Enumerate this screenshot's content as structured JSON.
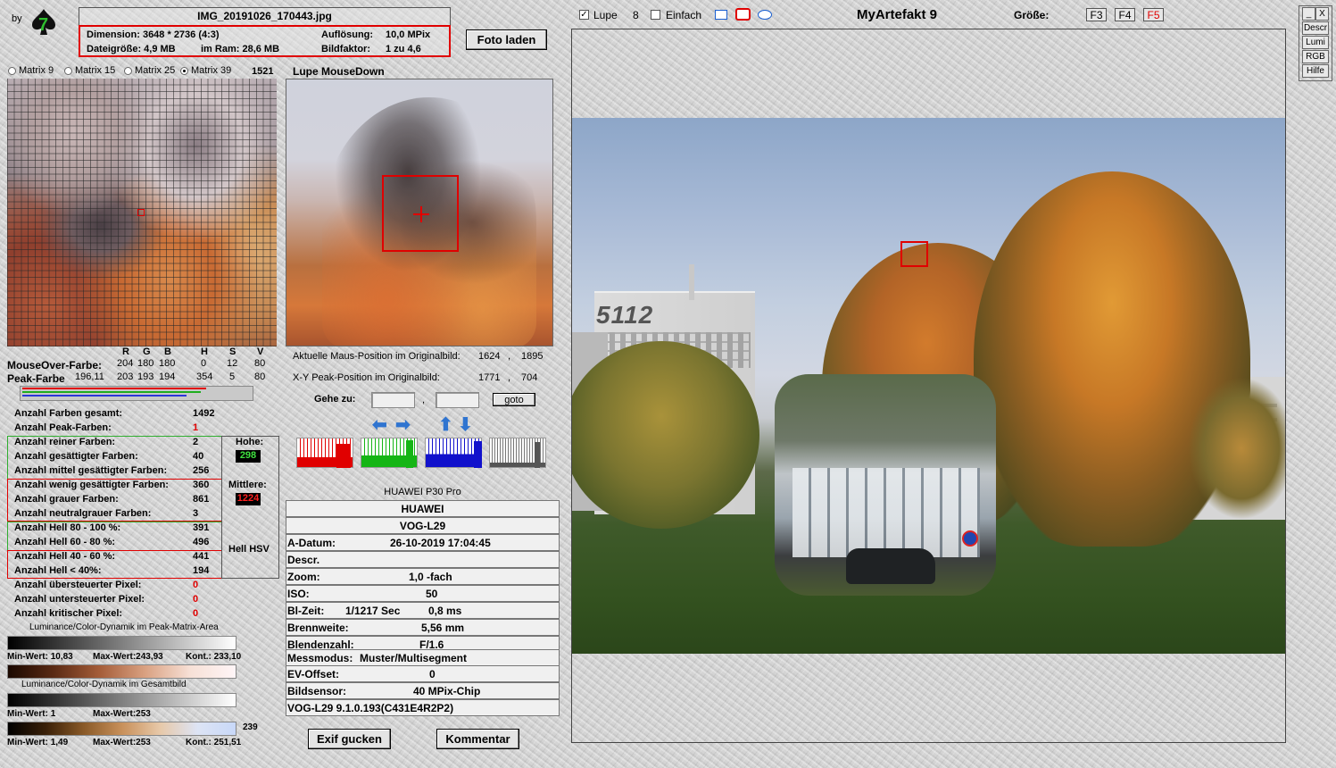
{
  "app": {
    "by_label": "by",
    "title": "MyArtefakt 9"
  },
  "file": {
    "name": "IMG_20191026_170443.jpg",
    "dimension": "Dimension: 3648 * 2736 (4:3)",
    "aufloesung_label": "Auflösung:",
    "aufloesung_value": "10,0 MPix",
    "dateigroesse": "Dateigröße: 4,9 MB",
    "im_ram": "im Ram: 28,6 MB",
    "bildfaktor_label": "Bildfaktor:",
    "bildfaktor_value": "1 zu 4,6"
  },
  "buttons": {
    "foto_laden": "Foto laden",
    "exif_gucken": "Exif gucken",
    "kommentar": "Kommentar",
    "goto": "goto"
  },
  "matrix": {
    "options": [
      "Matrix 9",
      "Matrix 15",
      "Matrix 25",
      "Matrix 39"
    ],
    "selected": "Matrix 39",
    "count": "1521"
  },
  "lupe_title": "Lupe MouseDown",
  "colors": {
    "headers": [
      "R",
      "G",
      "B",
      "H",
      "S",
      "V"
    ],
    "mouseover_label": "MouseOver-Farbe:",
    "mouseover_values": [
      "204",
      "180",
      "180",
      "0",
      "12",
      "80"
    ],
    "peak_label": "Peak-Farbe",
    "peak_id": "196,11",
    "peak_values": [
      "203",
      "193",
      "194",
      "354",
      "5",
      "80"
    ]
  },
  "positions": {
    "maus_label": "Aktuelle Maus-Position  im Originalbild:",
    "maus_x": "1624",
    "maus_y": "1895",
    "peak_label": "X-Y Peak-Position  im Originalbild:",
    "peak_x": "1771",
    "peak_y": "704",
    "sep": ",",
    "gehe_zu": "Gehe zu:",
    "gehe_sep": ","
  },
  "stats": {
    "farben_gesamt": {
      "label": "Anzahl Farben gesamt:",
      "value": "1492"
    },
    "peak_farben": {
      "label": "Anzahl Peak-Farben:",
      "value": "1"
    },
    "reine": {
      "label": "Anzahl reiner Farben:",
      "value": "2"
    },
    "gesaettigt": {
      "label": "Anzahl gesättigter Farben:",
      "value": "40"
    },
    "mittel": {
      "label": "Anzahl mittel gesättigter Farben:",
      "value": "256"
    },
    "wenig": {
      "label": "Anzahl wenig gesättigter Farben:",
      "value": "360"
    },
    "grau": {
      "label": "Anzahl grauer Farben:",
      "value": "861"
    },
    "neutralgrau": {
      "label": "Anzahl neutralgrauer Farben:",
      "value": "3"
    },
    "hell80": {
      "label": "Anzahl Hell 80 - 100 %:",
      "value": "391"
    },
    "hell60": {
      "label": "Anzahl Hell 60 - 80 %:",
      "value": "496"
    },
    "hell40": {
      "label": "Anzahl Hell 40 - 60 %:",
      "value": "441"
    },
    "hell0": {
      "label": "Anzahl Hell < 40%:",
      "value": "194"
    },
    "ueber": {
      "label": "Anzahl übersteuerter Pixel:",
      "value": "0"
    },
    "unter": {
      "label": "Anzahl untersteuerter Pixel:",
      "value": "0"
    },
    "kritisch": {
      "label": "Anzahl kritischer Pixel:",
      "value": "0"
    },
    "hohe_label": "Hohe:",
    "hohe_value": "298",
    "mittlere_label": "Mittlere:",
    "mittlere_value": "1224",
    "hell_hsv": "Hell HSV"
  },
  "dynamics": {
    "peak_title": "Luminance/Color-Dynamik im Peak-Matrix-Area",
    "peak_min": "Min-Wert: 10,83",
    "peak_max": "Max-Wert:243,93",
    "peak_kont": "Kont.: 233,10",
    "gesamt_title": "Luminance/Color-Dynamik im Gesamtbild",
    "gesamt_min": "Min-Wert: 1",
    "gesamt_max": "Max-Wert:253",
    "third_value": "239",
    "third_min": "Min-Wert: 1,49",
    "third_max": "Max-Wert:253",
    "third_kont": "Kont.: 251,51"
  },
  "exif": {
    "camera_header": "HUAWEI P30 Pro",
    "make": "HUAWEI",
    "model": "VOG-L29",
    "a_datum_label": "A-Datum:",
    "a_datum": "26-10-2019 17:04:45",
    "descr_label": "Descr.",
    "zoom_label": "Zoom:",
    "zoom": "1,0 -fach",
    "iso_label": "ISO:",
    "iso": "50",
    "bel_label": "Bl-Zeit:",
    "bel_value": "1/1217  Sec",
    "bel_ms": "0,8 ms",
    "brennweite_label": "Brennweite:",
    "brennweite": "5,56  mm",
    "blende_label": "Blendenzahl:",
    "blende": "F/1.6",
    "messmodus_label": "Messmodus:",
    "messmodus": "Muster/Multisegment",
    "ev_label": "EV-Offset:",
    "ev": "0",
    "sensor_label": "Bildsensor:",
    "sensor": "40 MPix-Chip",
    "firmware": "VOG-L29 9.1.0.193(C431E4R2P2)"
  },
  "toolbar": {
    "lupe_label": "Lupe",
    "lupe_checked": true,
    "lupe_size": "8",
    "einfach_label": "Einfach",
    "einfach_checked": false,
    "groesse_label": "Größe:",
    "f3": "F3",
    "f4": "F4",
    "f5": "F5",
    "f5_color": "#e00000"
  },
  "side_buttons": {
    "minimize": "_",
    "close": "X",
    "descr": "Descr",
    "lumi": "Lumi",
    "rgb": "RGB",
    "hilfe": "Hilfe"
  },
  "photo": {
    "building_text": "5112"
  }
}
